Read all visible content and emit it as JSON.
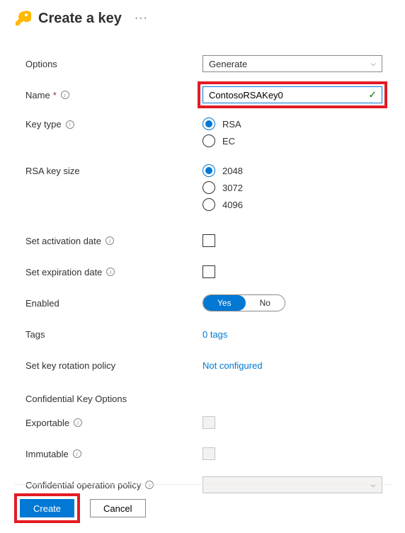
{
  "header": {
    "title": "Create a key"
  },
  "form": {
    "options": {
      "label": "Options",
      "value": "Generate"
    },
    "name": {
      "label": "Name",
      "value": "ContosoRSAKey0"
    },
    "keyType": {
      "label": "Key type",
      "options": [
        {
          "label": "RSA",
          "checked": true
        },
        {
          "label": "EC",
          "checked": false
        }
      ]
    },
    "rsaKeySize": {
      "label": "RSA key size",
      "options": [
        {
          "label": "2048",
          "checked": true
        },
        {
          "label": "3072",
          "checked": false
        },
        {
          "label": "4096",
          "checked": false
        }
      ]
    },
    "activationDate": {
      "label": "Set activation date",
      "checked": false
    },
    "expirationDate": {
      "label": "Set expiration date",
      "checked": false
    },
    "enabled": {
      "label": "Enabled",
      "yes": "Yes",
      "no": "No",
      "value": true
    },
    "tags": {
      "label": "Tags",
      "link": "0 tags"
    },
    "rotationPolicy": {
      "label": "Set key rotation policy",
      "link": "Not configured"
    },
    "confidentialHeading": "Confidential Key Options",
    "exportable": {
      "label": "Exportable",
      "checked": false
    },
    "immutable": {
      "label": "Immutable",
      "checked": false
    },
    "confidentialPolicy": {
      "label": "Confidential operation policy",
      "value": ""
    }
  },
  "footer": {
    "create": "Create",
    "cancel": "Cancel"
  }
}
